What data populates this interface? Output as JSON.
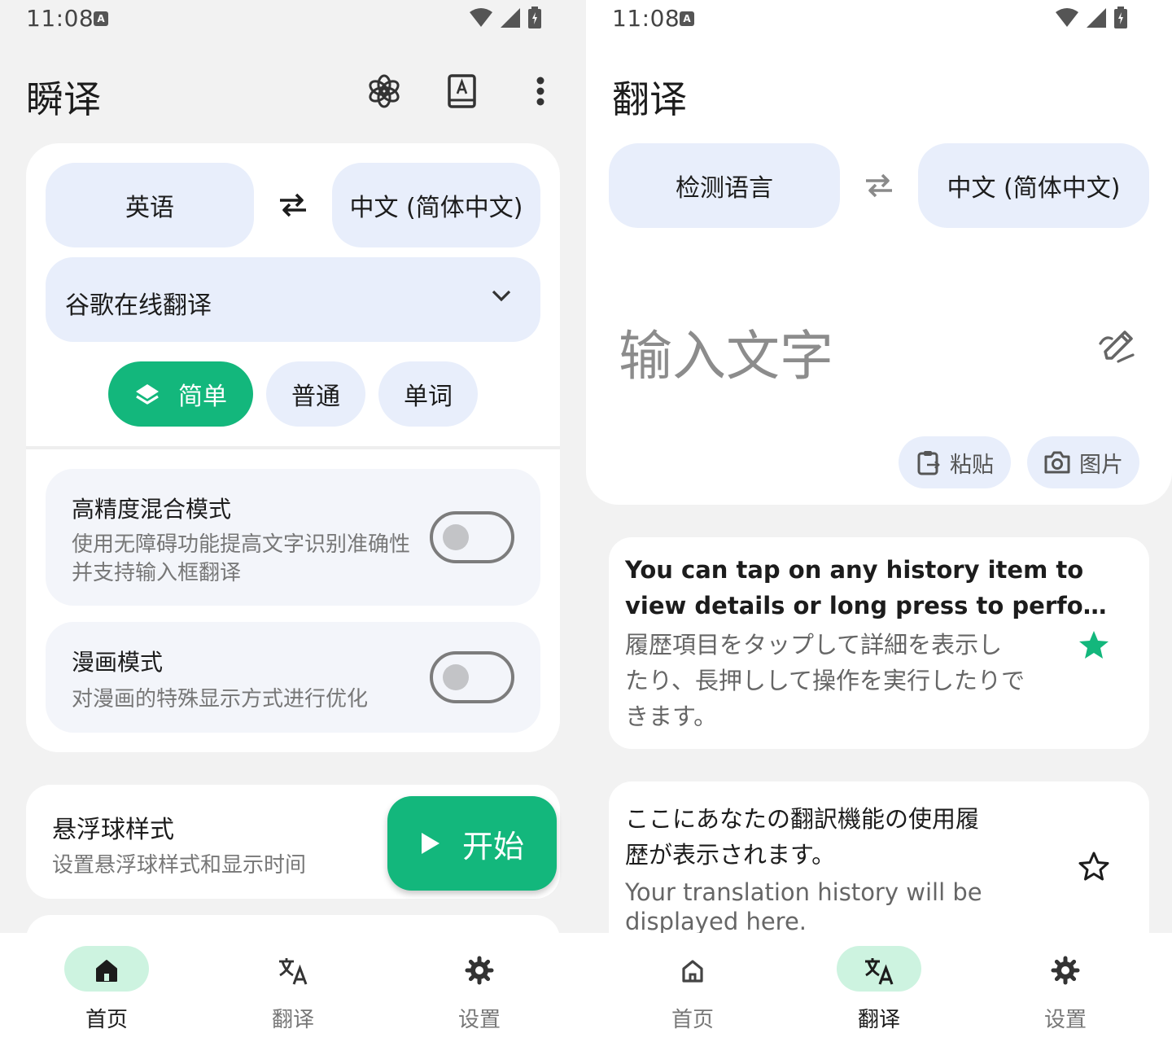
{
  "colors": {
    "accent": "#13b77c",
    "accent_light": "#cdf3e0",
    "pill_bg": "#e8eefb",
    "surface": "#f2f2f2"
  },
  "left": {
    "status": {
      "time": "11:08",
      "badge": "A"
    },
    "appbar": {
      "title": "瞬译",
      "icons": [
        "chatgpt-icon",
        "dictionary-icon",
        "more-vert-icon"
      ]
    },
    "languages": {
      "source": "英语",
      "target": "中文 (简体中文)"
    },
    "engine": {
      "label": "谷歌在线翻译"
    },
    "modes": {
      "simple": "简单",
      "normal": "普通",
      "word": "单词",
      "selected": "简单"
    },
    "settings": {
      "hybrid": {
        "title": "高精度混合模式",
        "desc_line1": "使用无障碍功能提高文字识别准确性",
        "desc_line2": "并支持输入框翻译",
        "enabled": false
      },
      "comic": {
        "title": "漫画模式",
        "desc": "对漫画的特殊显示方式进行优化",
        "enabled": false
      }
    },
    "float": {
      "title": "悬浮球样式",
      "desc": "设置悬浮球样式和显示时间"
    },
    "fab": {
      "label": "开始"
    },
    "nav": {
      "home": "首页",
      "translate": "翻译",
      "settings": "设置",
      "active": "首页"
    }
  },
  "right": {
    "status": {
      "time": "11:08",
      "badge": "A"
    },
    "appbar": {
      "title": "翻译"
    },
    "languages": {
      "source": "检测语言",
      "target": "中文 (简体中文)"
    },
    "input": {
      "placeholder": "输入文字"
    },
    "actions": {
      "paste": "粘贴",
      "image": "图片"
    },
    "history": [
      {
        "source_line1": "You can tap on any history item to",
        "source_line2": "view details or long press to perfo…",
        "target_line1": "履歴項目をタップして詳細を表示し",
        "target_line2": "たり、長押しして操作を実行したりで",
        "target_line3": "きます。",
        "starred": true
      },
      {
        "source_line1": "ここにあなたの翻訳機能の使用履",
        "source_line2": "歴が表示されます。",
        "target_line1": "Your translation history will be",
        "target_line2": "displayed here.",
        "starred": false
      }
    ],
    "nav": {
      "home": "首页",
      "translate": "翻译",
      "settings": "设置",
      "active": "翻译"
    }
  }
}
